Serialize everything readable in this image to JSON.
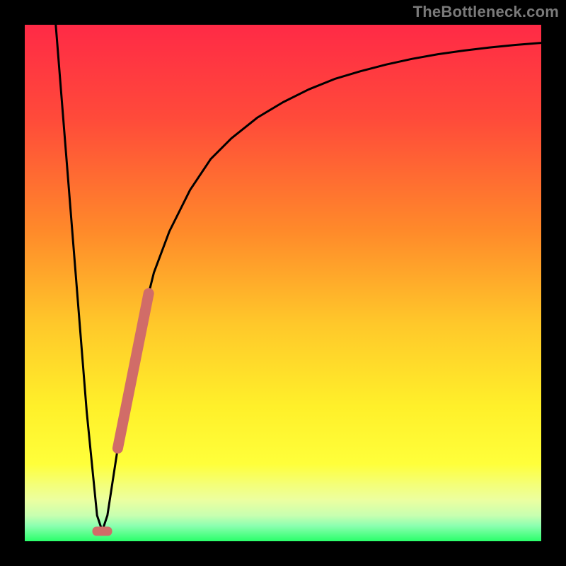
{
  "watermark": "TheBottleneck.com",
  "colors": {
    "frame": "#000000",
    "gradient_top": "#ff2a46",
    "gradient_mid1": "#ff8a2a",
    "gradient_mid2": "#ffd62a",
    "gradient_mid3": "#ffff2a",
    "gradient_band": "#f4ff78",
    "gradient_bottom": "#2aff6a",
    "curve": "#000000",
    "highlight": "#d16c68"
  },
  "chart_data": {
    "type": "line",
    "title": "",
    "xlabel": "",
    "ylabel": "",
    "xlim": [
      0,
      100
    ],
    "ylim": [
      0,
      100
    ],
    "series": [
      {
        "name": "bottleneck-curve",
        "x": [
          6,
          8,
          10,
          12,
          14,
          15,
          16,
          18,
          20,
          22,
          25,
          28,
          32,
          36,
          40,
          45,
          50,
          55,
          60,
          65,
          70,
          75,
          80,
          85,
          90,
          95,
          100
        ],
        "y": [
          100,
          75,
          50,
          25,
          5,
          2,
          5,
          18,
          30,
          40,
          52,
          60,
          68,
          74,
          78,
          82,
          85,
          87.5,
          89.5,
          91,
          92.3,
          93.4,
          94.3,
          95,
          95.6,
          96.1,
          96.5
        ]
      }
    ],
    "annotations": [
      {
        "name": "optimal-marker",
        "x": 15,
        "y": 2
      },
      {
        "name": "highlight-segment",
        "x_range": [
          18,
          24
        ],
        "y_range": [
          18,
          45
        ]
      }
    ]
  }
}
